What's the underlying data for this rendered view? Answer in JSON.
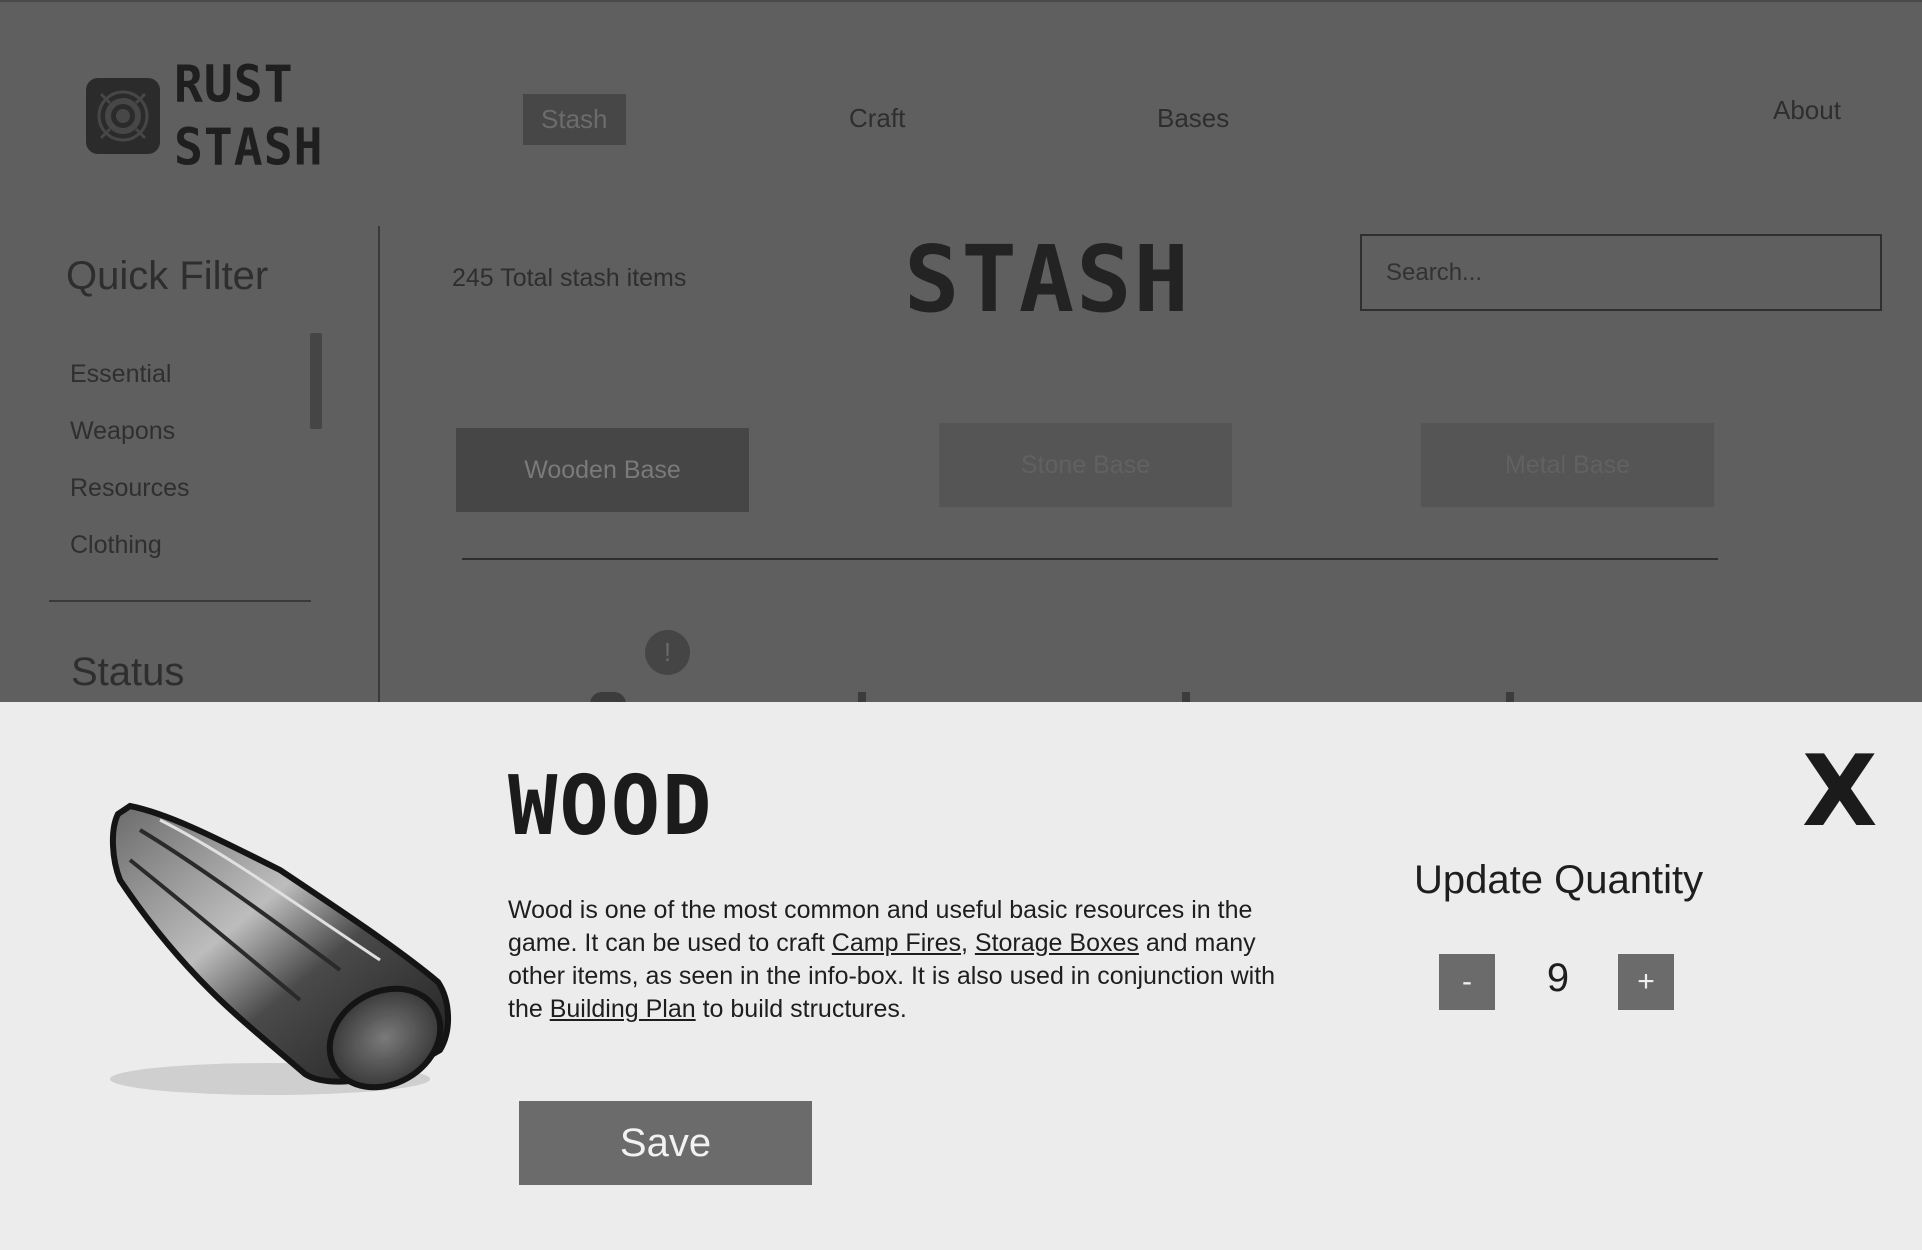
{
  "app": {
    "logo": {
      "line1": "RUST",
      "line2": "STASH",
      "icon": "rust-stash-logo-icon"
    },
    "nav": [
      {
        "label": "Stash",
        "active": true
      },
      {
        "label": "Craft",
        "active": false
      },
      {
        "label": "Bases",
        "active": false
      },
      {
        "label": "About",
        "active": false
      }
    ]
  },
  "sidebar": {
    "title": "Quick Filter",
    "filters": [
      "Essential",
      "Weapons",
      "Resources",
      "Clothing"
    ],
    "status_title": "Status"
  },
  "main": {
    "total_items": "245 Total stash items",
    "title": "STASH",
    "search": {
      "placeholder": "Search...",
      "value": ""
    },
    "bases": [
      {
        "label": "Wooden Base",
        "active": true
      },
      {
        "label": "Stone Base",
        "active": false
      },
      {
        "label": "Metal Base",
        "active": false
      }
    ],
    "alert_icon": "!"
  },
  "modal": {
    "item_name": "WOOD",
    "image_icon": "wood-log-image",
    "description": {
      "part1": "Wood is one of the most common and useful basic resources in the game. It can be used to craft ",
      "link1": "Camp Fires",
      "sep": ", ",
      "link2": "Storage Boxes",
      "part2": " and many other items, as seen in the info-box. It is also used in conjunction with the ",
      "link3": "Building Plan",
      "part3": " to build structures."
    },
    "save_label": "Save",
    "close_label": "X",
    "update_quantity_label": "Update Quantity",
    "decrement_label": "-",
    "increment_label": "+",
    "quantity": "9"
  },
  "colors": {
    "overlay_bg": "#5f5f5f",
    "modal_bg": "#ececec",
    "button_gray": "#6b6b6b",
    "text_dark": "#1e1e1e"
  }
}
